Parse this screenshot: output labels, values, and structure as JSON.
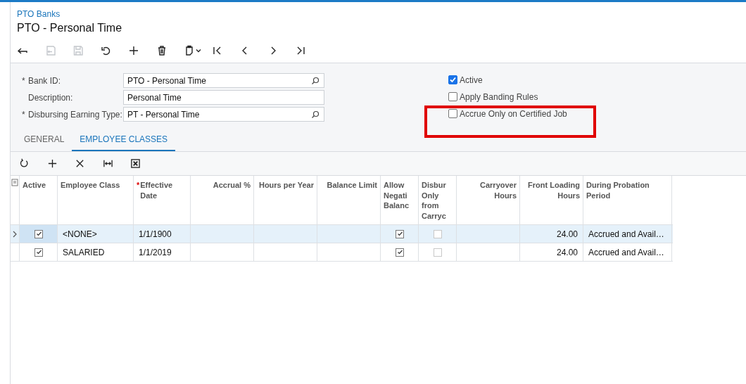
{
  "breadcrumb": "PTO Banks",
  "title": "PTO - Personal Time",
  "toolbar": [
    {
      "kind": "back",
      "disabled": false
    },
    {
      "kind": "save-close",
      "disabled": true
    },
    {
      "kind": "save",
      "disabled": true
    },
    {
      "kind": "undo",
      "disabled": false
    },
    {
      "kind": "add",
      "disabled": false
    },
    {
      "kind": "delete",
      "disabled": false
    },
    {
      "kind": "copy-paste",
      "disabled": false
    },
    {
      "kind": "first",
      "disabled": false
    },
    {
      "kind": "prev",
      "disabled": false
    },
    {
      "kind": "next",
      "disabled": false
    },
    {
      "kind": "last",
      "disabled": false
    }
  ],
  "fields": [
    {
      "marker": "*",
      "label": "Bank ID:",
      "value": "PTO - Personal Time",
      "lookup": true
    },
    {
      "label": "Description:",
      "value": "Personal Time",
      "lookup": false
    },
    {
      "marker": "*",
      "label": "Disbursing Earning Type:",
      "value": "PT - Personal Time",
      "lookup": true
    }
  ],
  "options": [
    {
      "label": "Active",
      "checked": true,
      "highlighted": false
    },
    {
      "label": "Apply Banding Rules",
      "checked": false,
      "highlighted": false
    },
    {
      "label": "Accrue Only on Certified Job",
      "checked": false,
      "highlighted": true
    }
  ],
  "tabs": [
    {
      "label": "GENERAL",
      "selected": false
    },
    {
      "label": "EMPLOYEE CLASSES",
      "selected": true
    }
  ],
  "grid_toolbar": [
    {
      "kind": "refresh"
    },
    {
      "kind": "add"
    },
    {
      "kind": "delete"
    },
    {
      "kind": "fit"
    },
    {
      "kind": "export"
    }
  ],
  "table": {
    "columns": [
      {
        "label": "Active",
        "kind": "check"
      },
      {
        "label": "Employee Class",
        "kind": "text"
      },
      {
        "marker": "*",
        "label": "Effective Date",
        "kind": "text"
      },
      {
        "label": "Accrual %",
        "kind": "number"
      },
      {
        "label": "Hours per Year",
        "kind": "number"
      },
      {
        "label": "Balance Limit",
        "kind": "number"
      },
      {
        "label": "Allow Negati Balanc",
        "kind": "check"
      },
      {
        "label": "Disbur Only from Carryc",
        "kind": "check"
      },
      {
        "label": "Carryover Hours",
        "kind": "number"
      },
      {
        "label": "Front Loading Hours",
        "kind": "number"
      },
      {
        "label": "During Probation Period",
        "kind": "text"
      }
    ],
    "rows": [
      {
        "selected": true,
        "cells": [
          true,
          "<NONE>",
          "1/1/1900",
          null,
          null,
          null,
          true,
          false,
          null,
          "24.00",
          "Accrued and Avail…"
        ]
      },
      {
        "selected": false,
        "cells": [
          true,
          "SALARIED",
          "1/1/2019",
          null,
          null,
          null,
          true,
          false,
          null,
          "24.00",
          "Accrued and Avail…"
        ]
      }
    ]
  }
}
